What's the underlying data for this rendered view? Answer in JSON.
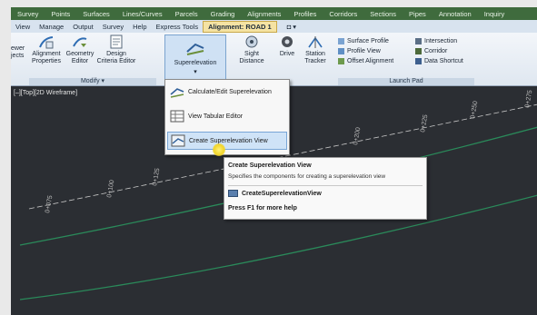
{
  "tabs": [
    "Survey",
    "Points",
    "Surfaces",
    "Lines/Curves",
    "Parcels",
    "Grading",
    "Alignments",
    "Profiles",
    "Corridors",
    "Sections",
    "Pipes",
    "Annotation",
    "Inquiry"
  ],
  "commands": [
    "View",
    "Manage",
    "Output",
    "Survey",
    "Help",
    "Express Tools"
  ],
  "context_tab": "Alignment: ROAD 1",
  "ribbon": {
    "left_cut": [
      "ewer",
      "jects"
    ],
    "alignment_properties": "Alignment Properties",
    "geometry_editor": "Geometry Editor",
    "design_criteria_editor": "Design Criteria Editor",
    "modify_panel": "Modify ▾",
    "superelevation": "Superelevation",
    "sight_distance": "Sight Distance",
    "drive": "Drive",
    "station_tracker": "Station Tracker",
    "launch_items": [
      "Surface Profile",
      "Profile View",
      "Offset Alignment"
    ],
    "launch_items2": [
      "Intersection",
      "Corridor",
      "Data Shortcut"
    ],
    "launch_pad": "Launch Pad"
  },
  "view_label": "[–][Top][2D Wireframe]",
  "menu": {
    "items": [
      "Calculate/Edit Superelevation",
      "View Tabular Editor",
      "Create Superelevation View"
    ],
    "selected_index": 2
  },
  "tooltip": {
    "title": "Create Superelevation View",
    "description": "Specifies the components for creating a superelevation view",
    "command": "CreateSuperelevationView",
    "help": "Press F1 for more help"
  },
  "stations": [
    "0+075",
    "0+100",
    "0+125",
    "0+200",
    "0+225",
    "0+250",
    "0+275"
  ]
}
